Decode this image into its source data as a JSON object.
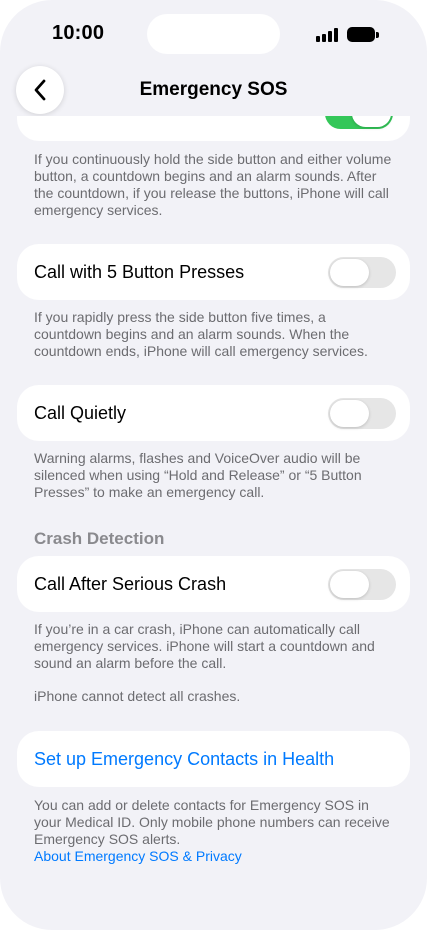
{
  "status_bar": {
    "time": "10:00"
  },
  "nav": {
    "title": "Emergency SOS",
    "back_icon": "chevron-left-icon"
  },
  "hold_release": {
    "toggle_on": true,
    "footnote": "If you continuously hold the side button and either volume button, a countdown begins and an alarm sounds. After the countdown, if you release the buttons, iPhone will call emergency services."
  },
  "five_presses": {
    "label": "Call with 5 Button Presses",
    "toggle_on": false,
    "footnote": "If you rapidly press the side button five times, a countdown begins and an alarm sounds. When the countdown ends, iPhone will call emergency services."
  },
  "call_quietly": {
    "label": "Call Quietly",
    "toggle_on": false,
    "footnote": "Warning alarms, flashes and VoiceOver audio will be silenced when using “Hold and Release” or “5 Button Presses” to make an emergency call."
  },
  "crash_detection": {
    "header": "Crash Detection",
    "label": "Call After Serious Crash",
    "toggle_on": false,
    "footnote": "If you’re in a car crash, iPhone can automatically call emergency services. iPhone will start a countdown and sound an alarm before the call.",
    "footnote2": "iPhone cannot detect all crashes."
  },
  "emergency_contacts": {
    "label": "Set up Emergency Contacts in Health",
    "footnote": "You can add or delete contacts for Emergency SOS in your Medical ID. Only mobile phone numbers can receive Emergency SOS alerts.",
    "privacy_link": "About Emergency SOS & Privacy"
  },
  "colors": {
    "accent": "#007aff",
    "toggle_on": "#34c759",
    "toggle_off": "#e6e6e6",
    "background": "#f2f2f7"
  }
}
